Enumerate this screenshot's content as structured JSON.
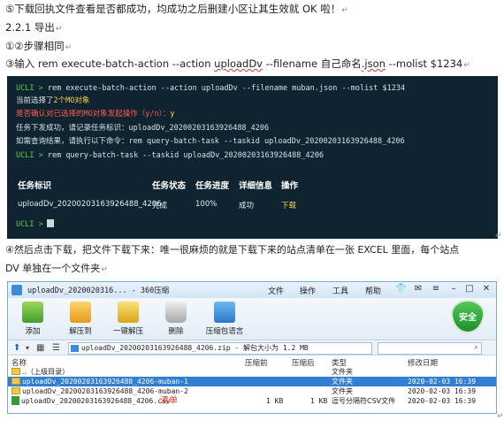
{
  "doc": {
    "line1": "⑤下载回执文件查看是否都成功，均成功之后删建小区让其生效就 OK 啦！",
    "line2": "2.2.1  导出",
    "line3": "①②步骤相同",
    "line4_pre": "③输入 rem execute-batch-action --action ",
    "line4_u1": "uploadDv",
    "line4_mid": " --filename  自己命名",
    "line4_u2": ".json",
    "line4_post": " --molist $1234",
    "para1": "④然后点击下载，把文件下载下来：唯一很麻烦的就是下载下来的站点清单在一张 EXCEL 里面，每个站点",
    "para2": "DV 单独在一个文件夹",
    "para_mark": "↵",
    "ret_mark": "↵"
  },
  "terminal": {
    "prompt": "UCLI  >",
    "cmd1": "rem  execute-batch-action  --action  uploadDv  --filename  muban.json  --molist $1234",
    "l2_pre": "当前选择了",
    "l2_hl": "2个MO对象",
    "l3": "是否确认对已选择的MO对象发起操作（y/n）：",
    "l3_ans": "y",
    "l4": "任务下发成功，请记录任务标识：uploadDv_20200203163926488_4206",
    "l5": "如需查询结果，请执行以下命令：rem query-batch-task --taskid uploadDv_20200203163926488_4206",
    "cmd2": "rem  query-batch-task  --taskid  uploadDv_20200203163926488_4206",
    "headers": [
      "任务标识",
      "任务状态",
      "任务进度",
      "详细信息",
      "操作"
    ],
    "row": [
      "uploadDv_20200203163926488_4206",
      "完成",
      "100%",
      "成功",
      "下载"
    ]
  },
  "window": {
    "title": "uploadDv_2020020316...  - 360压缩",
    "menu": [
      "文件",
      "操作",
      "工具",
      "帮助"
    ],
    "tools": [
      "添加",
      "解压到",
      "一键解压",
      "删除",
      "压缩包语言"
    ],
    "safe_label": "安全",
    "path": "uploadDv_20200203163926488_4206.zip - 解包大小为 1.2 MB",
    "columns": [
      "名称",
      "压缩前",
      "压缩后",
      "类型",
      "修改日期"
    ],
    "rows": [
      {
        "name": "..（上级目录）",
        "before": "",
        "after": "",
        "type": "文件夹",
        "date": ""
      },
      {
        "name": "uploadDv_20200203163926488_4206-muban-1",
        "before": "",
        "after": "",
        "type": "文件夹",
        "date": "2020-02-03 16:39"
      },
      {
        "name": "uploadDv_20200203163926488_4206-muban-2",
        "before": "",
        "after": "",
        "type": "文件夹",
        "date": "2020-02-03 16:39"
      },
      {
        "name": "uploadDv_20200203163926488_4206.csv",
        "before": "1 KB",
        "after": "1 KB",
        "type": "逗号分隔符CSV文件",
        "date": "2020-02-03 16:39"
      }
    ],
    "annotation": "清单"
  }
}
